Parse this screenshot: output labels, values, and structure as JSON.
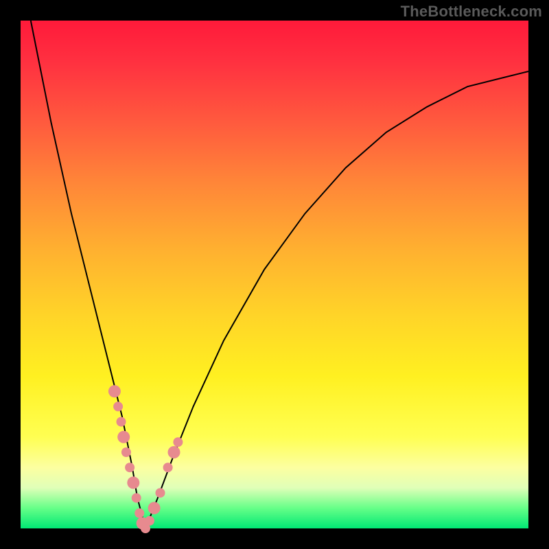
{
  "watermark": "TheBottleneck.com",
  "colors": {
    "frame_bg_top": "#ff1a3a",
    "frame_bg_bottom": "#00e874",
    "curve_stroke": "#000000",
    "marker_fill": "#e78a8f",
    "page_bg": "#000000",
    "watermark_color": "#5a5a5a"
  },
  "chart_data": {
    "type": "line",
    "title": "",
    "xlabel": "",
    "ylabel": "",
    "xlim": [
      0,
      100
    ],
    "ylim": [
      0,
      100
    ],
    "grid": false,
    "legend": false,
    "series": [
      {
        "name": "bottleneck-curve",
        "x": [
          2,
          4,
          6,
          8,
          10,
          12,
          14,
          16,
          18,
          20,
          21,
          22,
          23,
          24.6,
          27,
          30,
          34,
          40,
          48,
          56,
          64,
          72,
          80,
          88,
          96,
          100
        ],
        "values": [
          100,
          90,
          80,
          71,
          62,
          54,
          46,
          38,
          30,
          22,
          17,
          12,
          6,
          0,
          6,
          14,
          24,
          37,
          51,
          62,
          71,
          78,
          83,
          87,
          89,
          90
        ]
      }
    ],
    "annotations": {
      "markers_x": [
        18.5,
        19.2,
        19.8,
        20.3,
        20.8,
        21.5,
        22.2,
        22.8,
        23.4,
        24.0,
        24.6,
        25.4,
        26.3,
        27.5,
        29.0,
        30.2,
        31.0
      ],
      "markers_values": [
        27,
        24,
        21,
        18,
        15,
        12,
        9,
        6,
        3,
        1,
        0,
        1.5,
        4,
        7,
        12,
        15,
        17
      ],
      "marker_color": "#e78a8f"
    }
  }
}
